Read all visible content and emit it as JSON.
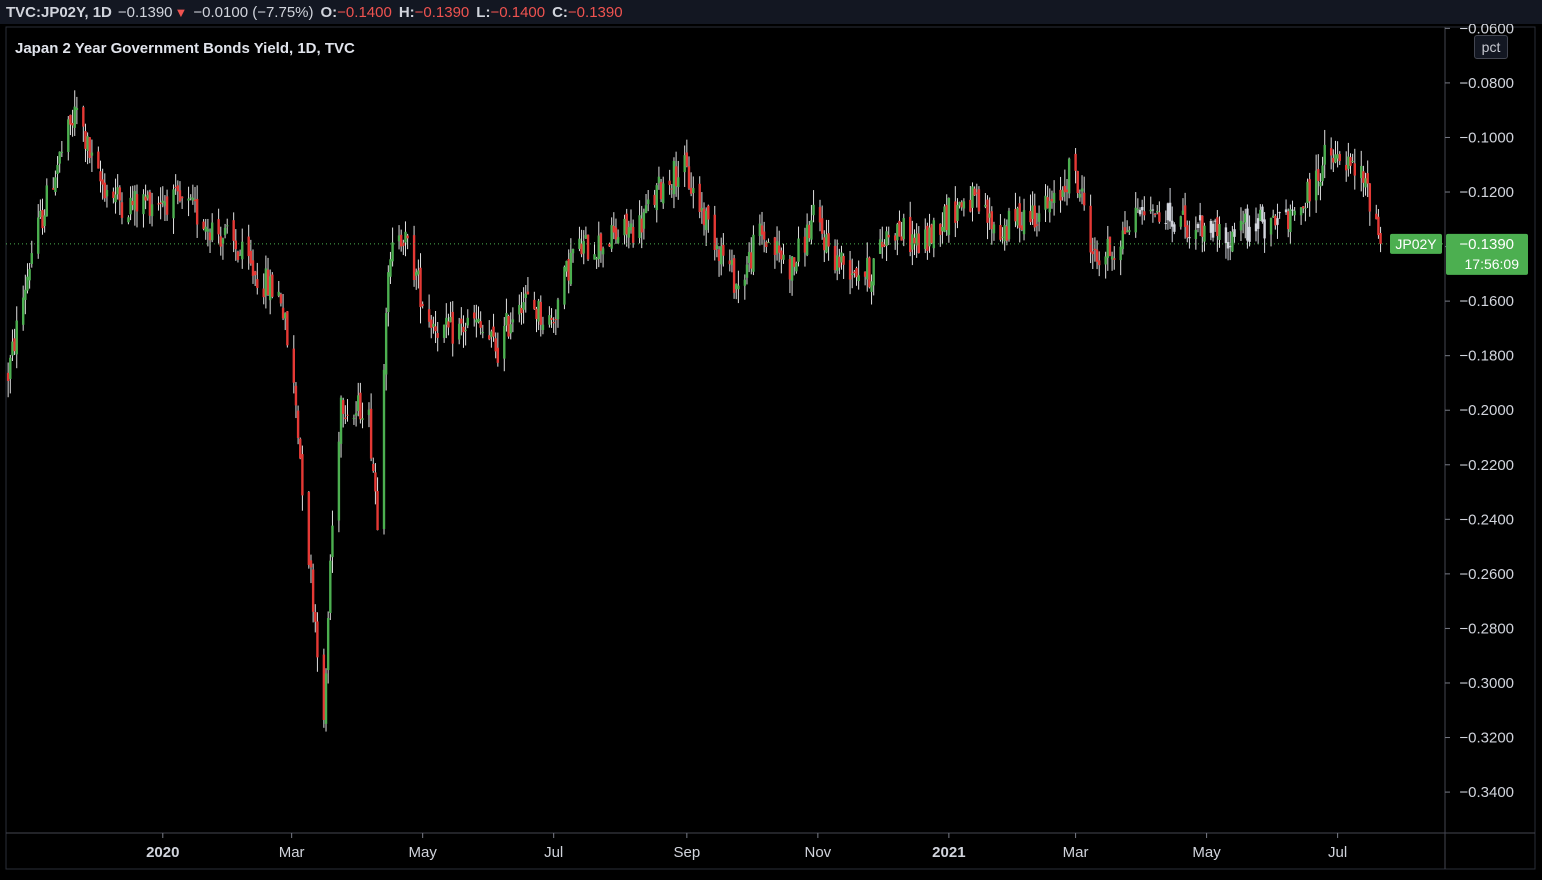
{
  "header": {
    "symbol": "TVC:JP02Y, 1D",
    "last": "−0.1390",
    "change": "−0.0100 (−7.75%)",
    "o_label": "O:",
    "o_value": "−0.1400",
    "h_label": "H:",
    "h_value": "−0.1390",
    "l_label": "L:",
    "l_value": "−0.1400",
    "c_label": "C:",
    "c_value": "−0.1390"
  },
  "unit_button": "pct",
  "colors": {
    "up": "#4caf50",
    "down": "#e53935",
    "flat": "#d1d4dc",
    "background": "#000000",
    "axis_text": "#d1d4dc"
  },
  "chart_data": {
    "type": "candlestick",
    "title": "Japan 2 Year Government Bonds Yield, 1D, TVC",
    "ylim": [
      -0.355,
      -0.0595
    ],
    "y_ticks": [
      "−0.0600",
      "−0.0800",
      "−0.1000",
      "−0.1200",
      "−0.1400",
      "−0.1600",
      "−0.1800",
      "−0.2000",
      "−0.2200",
      "−0.2400",
      "−0.2600",
      "−0.2800",
      "−0.3000",
      "−0.3200",
      "−0.3400"
    ],
    "y_tick_values": [
      -0.06,
      -0.08,
      -0.1,
      -0.12,
      -0.14,
      -0.16,
      -0.18,
      -0.2,
      -0.22,
      -0.24,
      -0.26,
      -0.28,
      -0.3,
      -0.32,
      -0.34
    ],
    "x_range": [
      "2019-10-20",
      "2021-08-20"
    ],
    "x_ticks": [
      "2020",
      "Mar",
      "May",
      "Jul",
      "Sep",
      "Nov",
      "2021",
      "Mar",
      "May",
      "Jul"
    ],
    "x_tick_dates": [
      "2020-01-01",
      "2020-03-01",
      "2020-05-01",
      "2020-07-01",
      "2020-09-01",
      "2020-11-01",
      "2021-01-01",
      "2021-03-01",
      "2021-05-01",
      "2021-07-01"
    ],
    "last_price": {
      "symbol": "JP02Y",
      "value": "−0.1390",
      "countdown": "17:56:09",
      "numeric": -0.139
    },
    "anchors": [
      [
        "2019-10-20",
        -0.191
      ],
      [
        "2019-11-01",
        -0.142
      ],
      [
        "2019-11-12",
        -0.112
      ],
      [
        "2019-11-22",
        -0.09
      ],
      [
        "2019-12-01",
        -0.115
      ],
      [
        "2019-12-15",
        -0.125
      ],
      [
        "2020-01-01",
        -0.122
      ],
      [
        "2020-01-15",
        -0.127
      ],
      [
        "2020-02-01",
        -0.138
      ],
      [
        "2020-02-15",
        -0.152
      ],
      [
        "2020-02-25",
        -0.158
      ],
      [
        "2020-03-03",
        -0.198
      ],
      [
        "2020-03-08",
        -0.245
      ],
      [
        "2020-03-13",
        -0.285
      ],
      [
        "2020-03-16",
        -0.318
      ],
      [
        "2020-03-19",
        -0.255
      ],
      [
        "2020-03-24",
        -0.195
      ],
      [
        "2020-03-30",
        -0.202
      ],
      [
        "2020-04-05",
        -0.195
      ],
      [
        "2020-04-10",
        -0.238
      ],
      [
        "2020-04-14",
        -0.16
      ],
      [
        "2020-04-19",
        -0.13
      ],
      [
        "2020-04-26",
        -0.145
      ],
      [
        "2020-05-03",
        -0.165
      ],
      [
        "2020-05-12",
        -0.172
      ],
      [
        "2020-05-25",
        -0.168
      ],
      [
        "2020-06-05",
        -0.178
      ],
      [
        "2020-06-15",
        -0.158
      ],
      [
        "2020-06-30",
        -0.168
      ],
      [
        "2020-07-10",
        -0.142
      ],
      [
        "2020-07-25",
        -0.138
      ],
      [
        "2020-08-10",
        -0.132
      ],
      [
        "2020-08-20",
        -0.118
      ],
      [
        "2020-08-30",
        -0.11
      ],
      [
        "2020-09-05",
        -0.122
      ],
      [
        "2020-09-15",
        -0.138
      ],
      [
        "2020-09-25",
        -0.155
      ],
      [
        "2020-10-05",
        -0.135
      ],
      [
        "2020-10-20",
        -0.148
      ],
      [
        "2020-10-30",
        -0.13
      ],
      [
        "2020-11-10",
        -0.145
      ],
      [
        "2020-11-25",
        -0.15
      ],
      [
        "2020-12-05",
        -0.132
      ],
      [
        "2020-12-20",
        -0.14
      ],
      [
        "2020-12-28",
        -0.13
      ],
      [
        "2021-01-10",
        -0.122
      ],
      [
        "2021-01-25",
        -0.135
      ],
      [
        "2021-02-05",
        -0.128
      ],
      [
        "2021-02-20",
        -0.125
      ],
      [
        "2021-02-27",
        -0.11
      ],
      [
        "2021-03-05",
        -0.125
      ],
      [
        "2021-03-10",
        -0.145
      ],
      [
        "2021-03-20",
        -0.14
      ],
      [
        "2021-04-01",
        -0.122
      ],
      [
        "2021-04-15",
        -0.13
      ],
      [
        "2021-05-01",
        -0.135
      ],
      [
        "2021-05-20",
        -0.133
      ],
      [
        "2021-06-05",
        -0.13
      ],
      [
        "2021-06-15",
        -0.125
      ],
      [
        "2021-06-25",
        -0.108
      ],
      [
        "2021-07-05",
        -0.11
      ],
      [
        "2021-07-12",
        -0.115
      ],
      [
        "2021-07-18",
        -0.125
      ],
      [
        "2021-07-21",
        -0.139
      ]
    ]
  }
}
